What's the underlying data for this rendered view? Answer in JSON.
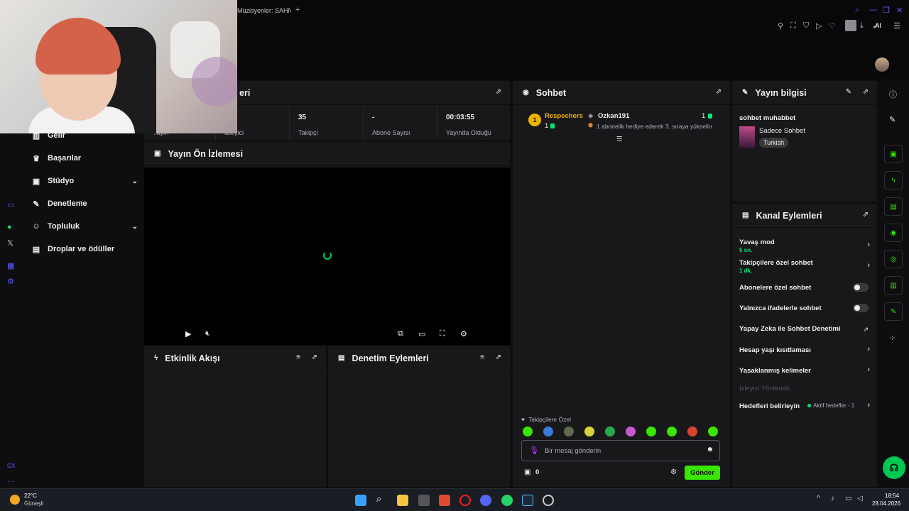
{
  "browser": {
    "tab_title": "Müzisyenler: SAHNE",
    "tab_plus": "+",
    "ai_label": "AI"
  },
  "nav": {
    "items": [
      {
        "label": "Gelir",
        "icon": "revenue-icon",
        "glyph": "▥"
      },
      {
        "label": "Başarılar",
        "icon": "trophy-icon",
        "glyph": "♛"
      },
      {
        "label": "Stüdyo",
        "icon": "studio-icon",
        "glyph": "▣",
        "expandable": true
      },
      {
        "label": "Denetleme",
        "icon": "wrench-icon",
        "glyph": "✎"
      },
      {
        "label": "Topluluk",
        "icon": "people-icon",
        "glyph": "☺",
        "expandable": true
      },
      {
        "label": "Droplar ve ödüller",
        "icon": "gift-icon",
        "glyph": "▤"
      }
    ]
  },
  "stream_panel": {
    "title_fragment": "eri",
    "stats": [
      {
        "value": "",
        "label": "Yayın"
      },
      {
        "value": "",
        "label": "İzleyici"
      },
      {
        "value": "35",
        "label": "Takipçi"
      },
      {
        "value": "-",
        "label": "Abone Sayısı"
      },
      {
        "value": "00:03:55",
        "label": "Yayında Olduğu"
      }
    ]
  },
  "preview": {
    "title": "Yayın Ön İzlemesi"
  },
  "activity": {
    "title": "Etkinlik Akışı"
  },
  "mod_actions": {
    "title": "Denetim Eylemleri"
  },
  "chat": {
    "title": "Sohbet",
    "event_user": "Respechers",
    "event_count": "1",
    "gifter": "Ozkan191",
    "gifter_count": "1",
    "event_text": "1 abonelik hediye ederek 3. sıraya yükselin",
    "follower_only_label": "Takipçilere Özel",
    "input_placeholder": "Bir mesaj gönderin",
    "points": "0",
    "send_label": "Gönder"
  },
  "stream_info": {
    "title": "Yayın bilgisi",
    "stream_title": "sohbet muhabbet",
    "category": "Sadece Sohbet",
    "language_tag": "Turkish"
  },
  "channel_actions": {
    "title": "Kanal Eylemleri",
    "items": [
      {
        "label": "Yavaş mod",
        "sub": "5 sn.",
        "control": "chevron"
      },
      {
        "label": "Takipçilere özel sohbet",
        "sub": "1 dk.",
        "control": "chevron"
      },
      {
        "label": "Abonelere özel sohbet",
        "sub": "",
        "control": "toggle",
        "on": false
      },
      {
        "label": "Yalnızca ifadelerle sohbet",
        "sub": "",
        "control": "toggle",
        "on": false
      },
      {
        "label": "Yapay Zeka ile Sohbet Denetimi",
        "sub": "",
        "control": "external"
      },
      {
        "label": "Hesap yaşı kısıtlaması",
        "sub": "",
        "control": "chevron"
      },
      {
        "label": "Yasaklanmış kelimeler",
        "sub": "",
        "control": "chevron"
      },
      {
        "label": "İzleyici Yönlendir",
        "sub": "",
        "control": "disabled"
      },
      {
        "label": "Hedefleri belirleyin",
        "sub": "",
        "control": "chevron",
        "extra": "Aktif hedefler - 1"
      }
    ]
  },
  "taskbar": {
    "weather_temp": "22°C",
    "weather_desc": "Güneşli",
    "time": "18:54",
    "date": "28.04.2026"
  },
  "colors": {
    "accent_green": "#39e600",
    "panel_bg": "#18181b",
    "page_bg": "#0e0e10",
    "rail_blue": "#5d5dff",
    "browser_accent": "#8a4cff"
  }
}
